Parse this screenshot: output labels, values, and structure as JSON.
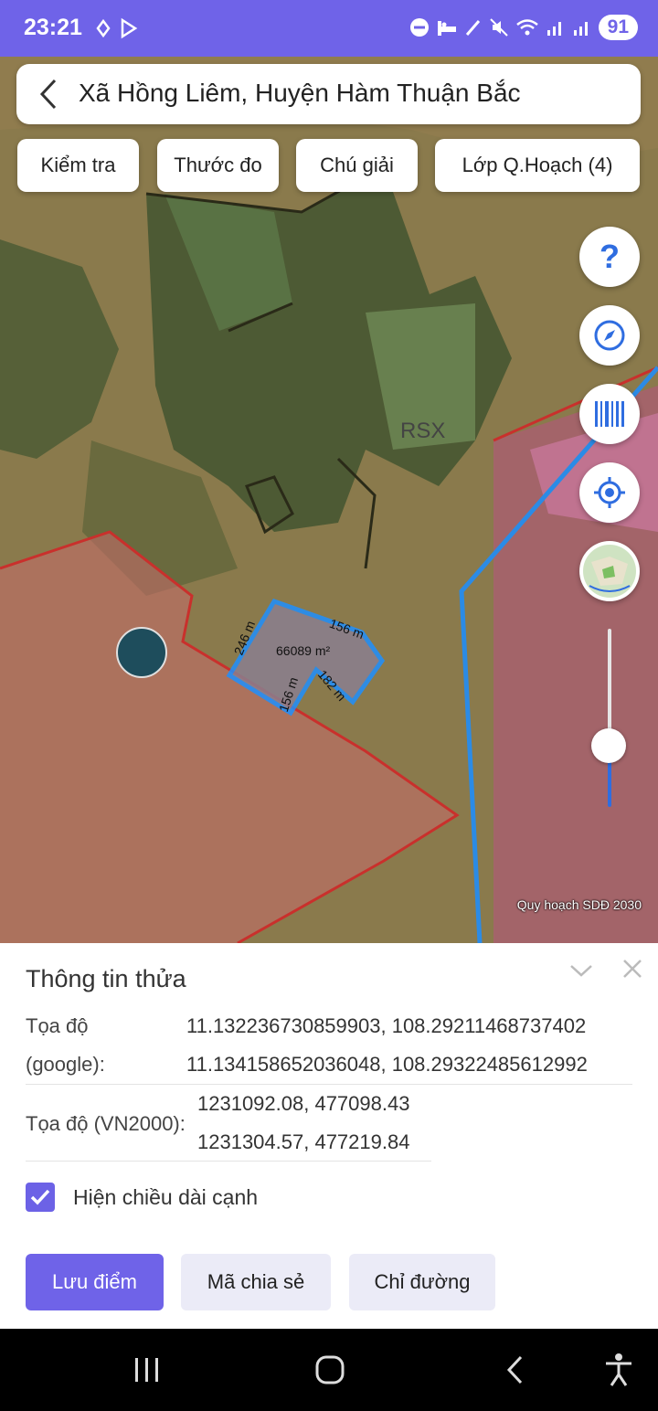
{
  "status_bar": {
    "time": "23:21",
    "battery": "91"
  },
  "search": {
    "location": "Xã Hồng Liêm, Huyện Hàm Thuận Bắc"
  },
  "toolbar": {
    "check": "Kiểm tra",
    "measure": "Thước đo",
    "legend": "Chú giải",
    "layers": "Lớp Q.Hoạch (4)"
  },
  "map": {
    "zone_label": "RSX",
    "area": "66089 m²",
    "edges": [
      "156 m",
      "246 m",
      "182 m",
      "156 m"
    ],
    "credit": "Quy hoạch SDĐ 2030"
  },
  "info_panel": {
    "title": "Thông tin thửa",
    "google_label_1": "Tọa độ",
    "google_label_2": "(google):",
    "google_coords": [
      "11.132236730859903, 108.29211468737402",
      "11.134158652036048, 108.29322485612992"
    ],
    "vn2000_label": "Tọa độ (VN2000):",
    "vn2000_coords": [
      "1231092.08, 477098.43",
      "1231304.57, 477219.84"
    ],
    "show_edges_label": "Hiện chiều dài cạnh",
    "show_edges_checked": true
  },
  "actions": {
    "save": "Lưu điểm",
    "share": "Mã chia sẻ",
    "directions": "Chỉ đường"
  },
  "colors": {
    "accent": "#6f63e8",
    "route": "#2b8be6",
    "parcel": "#1e90ff"
  }
}
